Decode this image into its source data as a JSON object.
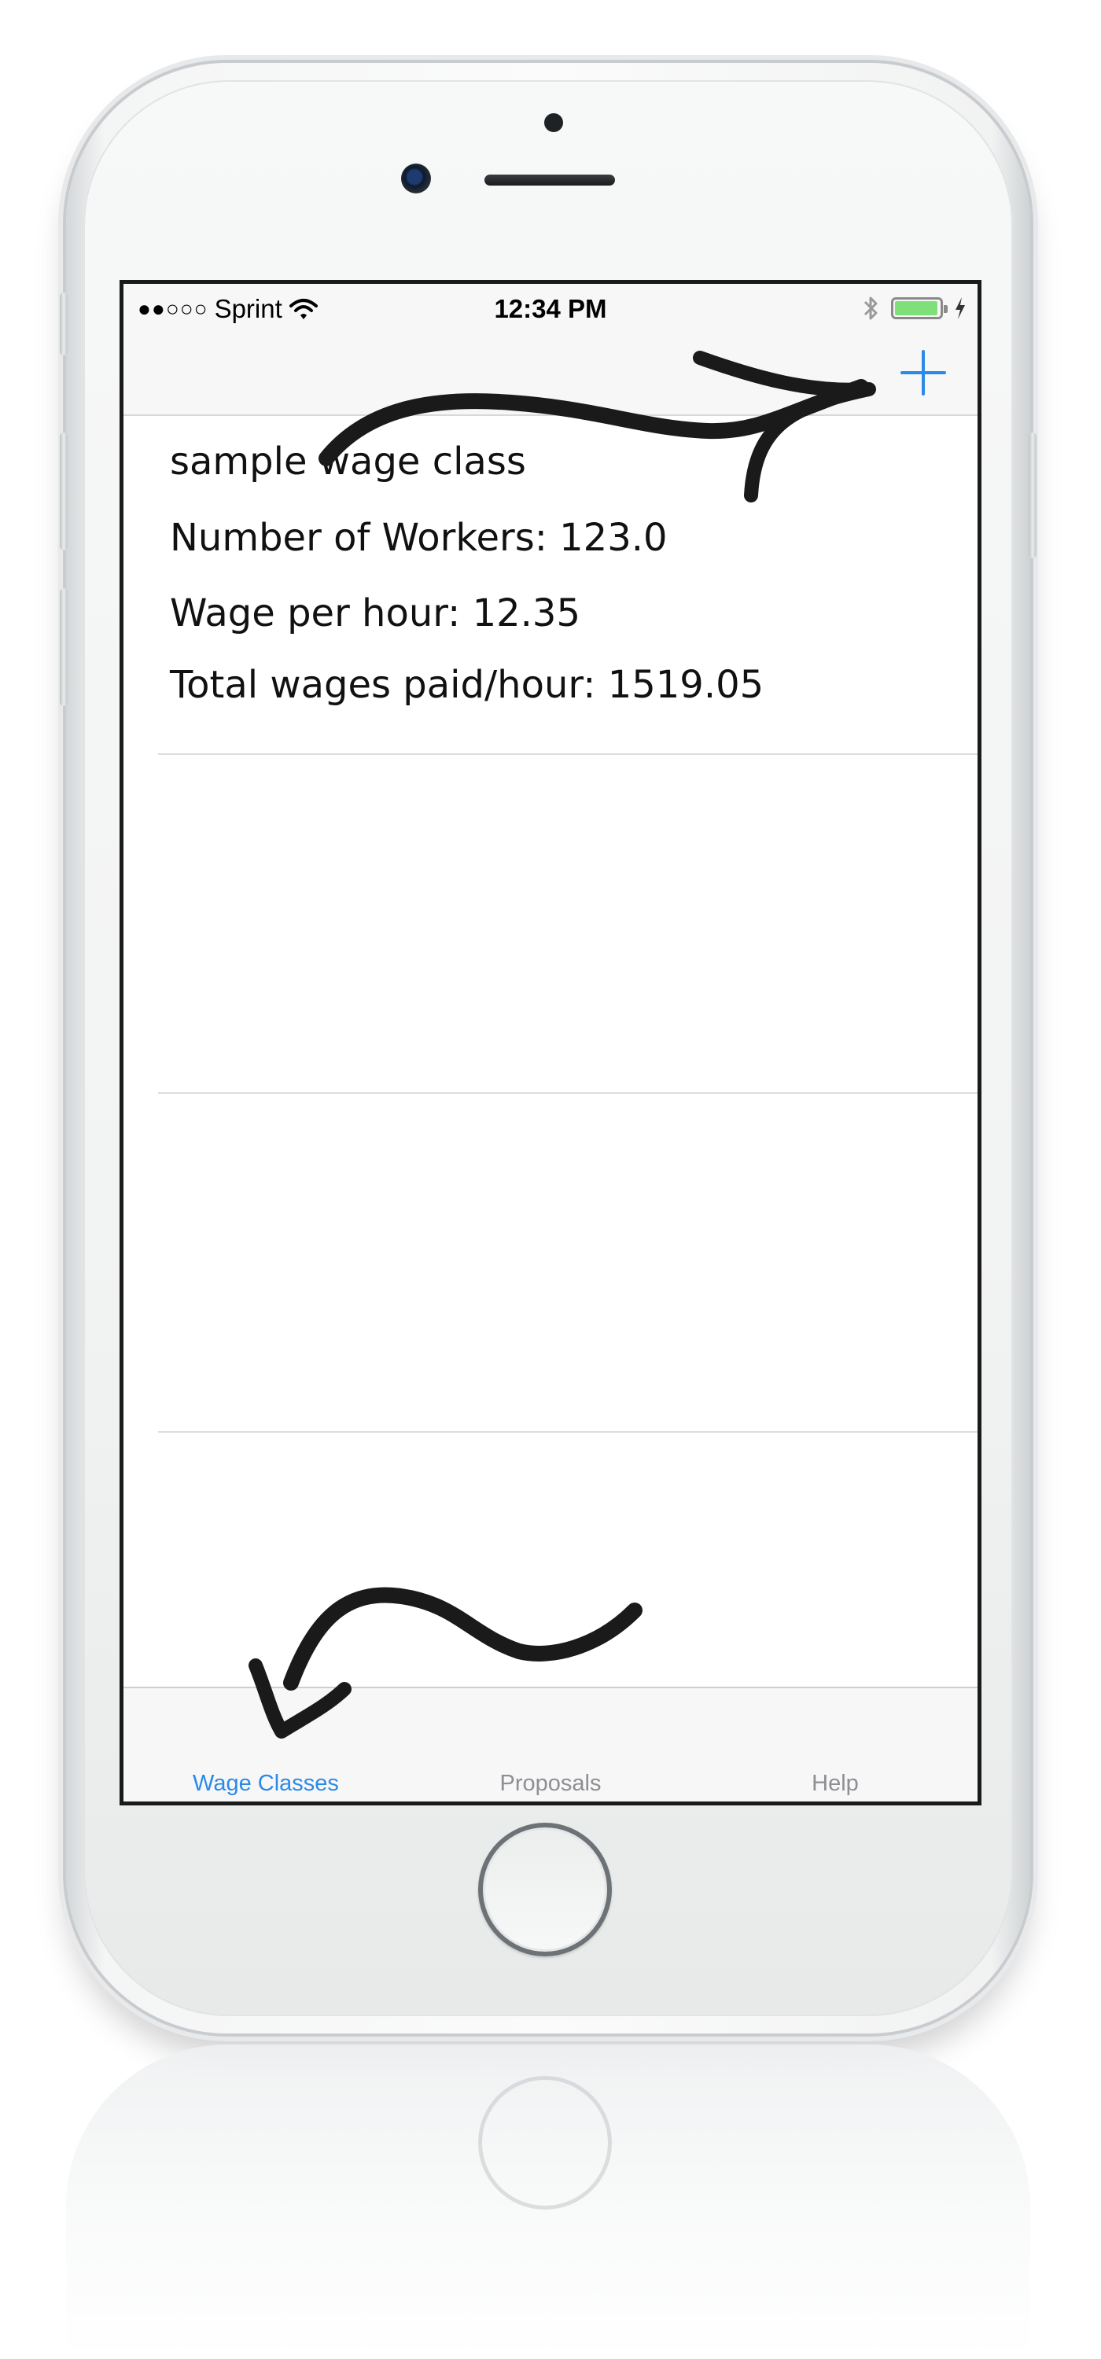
{
  "status_bar": {
    "signal": "●●○○○",
    "carrier": "Sprint",
    "time": "12:34 PM"
  },
  "nav_bar": {
    "add_icon": "plus-icon",
    "accent_color": "#2b8ae8"
  },
  "wage_classes": [
    {
      "name": "sample wage class",
      "workers": "Number of Workers: 123.0",
      "wage": "Wage per hour: 12.35",
      "total": "Total wages paid/hour: 1519.05"
    }
  ],
  "tab_bar": {
    "tabs": [
      {
        "label": "Wage Classes",
        "active": true
      },
      {
        "label": "Proposals",
        "active": false
      },
      {
        "label": "Help",
        "active": false
      }
    ]
  },
  "colors": {
    "active_tab": "#2b8ae8",
    "inactive_tab": "#8e8e93",
    "battery": "#7fe07a"
  }
}
